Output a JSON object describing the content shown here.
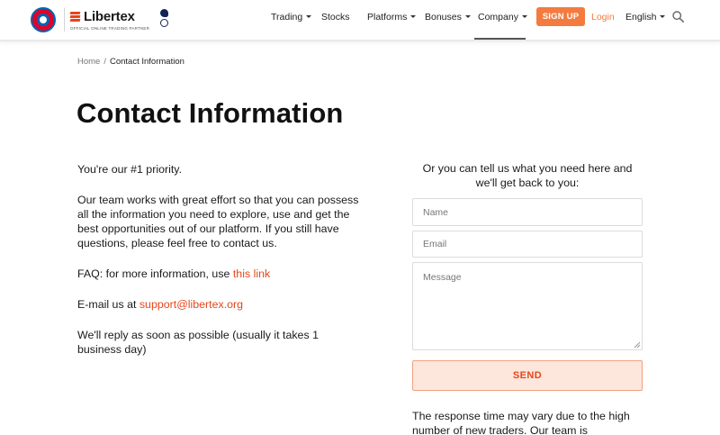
{
  "header": {
    "brand_name": "Libertex",
    "brand_tagline": "OFFICIAL ONLINE TRADING PARTNER",
    "nav": {
      "trading": "Trading",
      "stocks": "Stocks",
      "platforms": "Platforms",
      "bonuses": "Bonuses",
      "company": "Company"
    },
    "signup_label": "SIGN UP",
    "login_label": "Login",
    "language_label": "English",
    "accent_color": "#f47b3f",
    "icons": [
      "fc-bayern-badge-icon",
      "libertex-logo-icon",
      "tottenham-badge-icon",
      "chevron-down-icon",
      "search-icon"
    ]
  },
  "breadcrumb": {
    "home": "Home",
    "separator": "/",
    "current": "Contact Information"
  },
  "page_title": "Contact Information",
  "left": {
    "priority": "You're our #1 priority.",
    "team_text": "Our team works with great effort so that you can possess all the information you need to explore, use and get the best opportunities out of our platform. If you still have questions, please feel free to contact us.",
    "faq_prefix": "FAQ: for more information, use ",
    "faq_link": "this link",
    "email_prefix": "E-mail us at ",
    "email_link": "support@libertex.org",
    "reply_text": "We'll reply as soon as possible (usually it takes 1 business day)",
    "link_color": "#e6461b"
  },
  "form": {
    "intro": "Or you can tell us what you need here and we'll get back to you:",
    "name_placeholder": "Name",
    "email_placeholder": "Email",
    "message_placeholder": "Message",
    "send_label": "SEND",
    "response_note": "The response time may vary due to the high number of new traders. Our team is"
  }
}
